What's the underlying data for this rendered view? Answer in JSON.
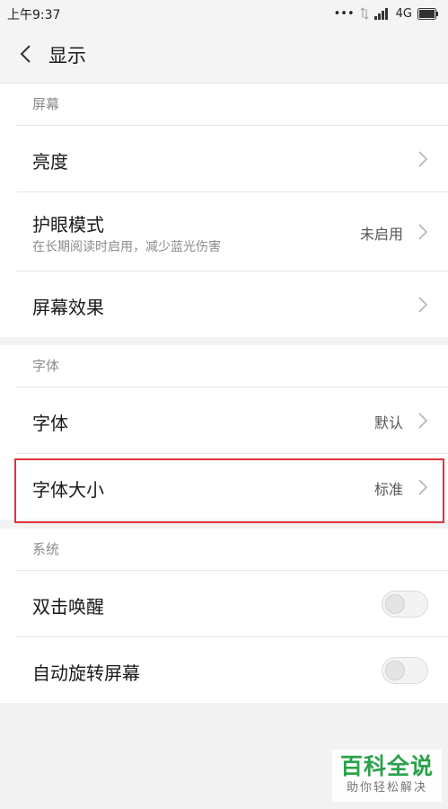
{
  "status_bar": {
    "time": "上午9:37",
    "dots": "•••",
    "network": "4G"
  },
  "header": {
    "title": "显示"
  },
  "sections": [
    {
      "title": "屏幕",
      "rows": [
        {
          "label": "亮度"
        },
        {
          "label": "护眼模式",
          "sub": "在长期阅读时启用，减少蓝光伤害",
          "value": "未启用"
        },
        {
          "label": "屏幕效果"
        }
      ]
    },
    {
      "title": "字体",
      "rows": [
        {
          "label": "字体",
          "value": "默认"
        },
        {
          "label": "字体大小",
          "value": "标准"
        }
      ]
    },
    {
      "title": "系统",
      "rows": [
        {
          "label": "双击唤醒",
          "toggle_on": false
        },
        {
          "label": "自动旋转屏幕",
          "toggle_on": false
        }
      ]
    }
  ],
  "watermark": {
    "main": "百科全说",
    "sub": "助你轻松解决"
  },
  "colors": {
    "highlight": "#e0333a",
    "watermark": "#2aa24a"
  },
  "icons": [
    "chevron-left-icon",
    "chevron-right-icon",
    "signal-icon",
    "toggle-switch"
  ]
}
